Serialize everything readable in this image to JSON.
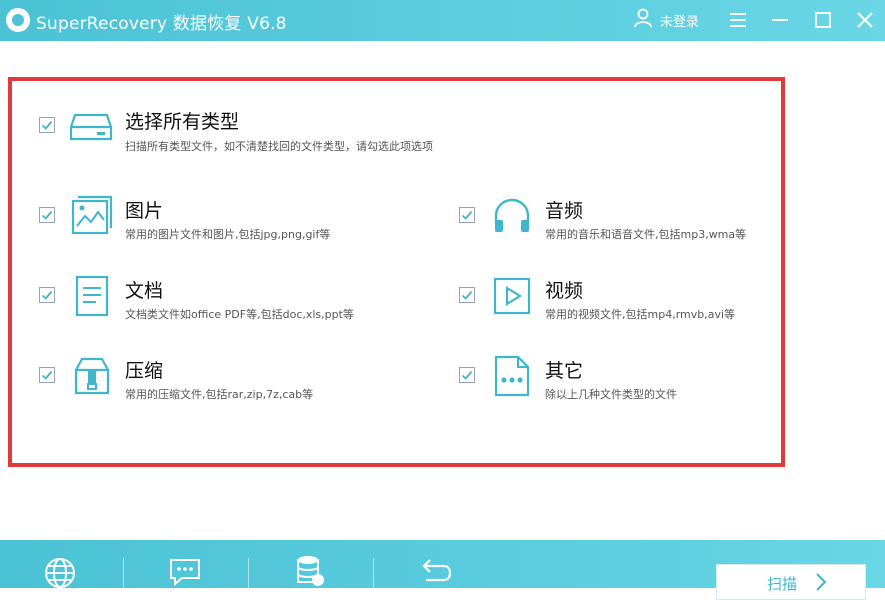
{
  "app": {
    "title": "SuperRecovery 数据恢复 V6.8"
  },
  "user": {
    "label": "未登录"
  },
  "colors": {
    "accent": "#4cc2d6",
    "highlight_border": "#e03a3a",
    "check": "#4aaec4"
  },
  "options": [
    {
      "id": "all",
      "title": "选择所有类型",
      "desc": "扫描所有类型文件，如不清楚找回的文件类型，请勾选此项选项",
      "checked": true,
      "icon": "drive-icon"
    },
    {
      "id": "images",
      "title": "图片",
      "desc": "常用的图片文件和图片,包括jpg,png,gif等",
      "checked": true,
      "icon": "image-icon"
    },
    {
      "id": "audio",
      "title": "音频",
      "desc": "常用的音乐和语音文件,包括mp3,wma等",
      "checked": true,
      "icon": "headphones-icon"
    },
    {
      "id": "docs",
      "title": "文档",
      "desc": "文档类文件如office PDF等,包括doc,xls,ppt等",
      "checked": true,
      "icon": "document-icon"
    },
    {
      "id": "video",
      "title": "视频",
      "desc": "常用的视频文件,包括mp4,rmvb,avi等",
      "checked": true,
      "icon": "play-icon"
    },
    {
      "id": "archive",
      "title": "压缩",
      "desc": "常用的压缩文件,包括rar,zip,7z,cab等",
      "checked": true,
      "icon": "archive-icon"
    },
    {
      "id": "other",
      "title": "其它",
      "desc": "除以上几种文件类型的文件",
      "checked": true,
      "icon": "more-icon"
    }
  ],
  "bottom": {
    "icons": [
      "globe-icon",
      "chat-icon",
      "database-icon",
      "back-icon"
    ],
    "scan_label": "扫描"
  }
}
